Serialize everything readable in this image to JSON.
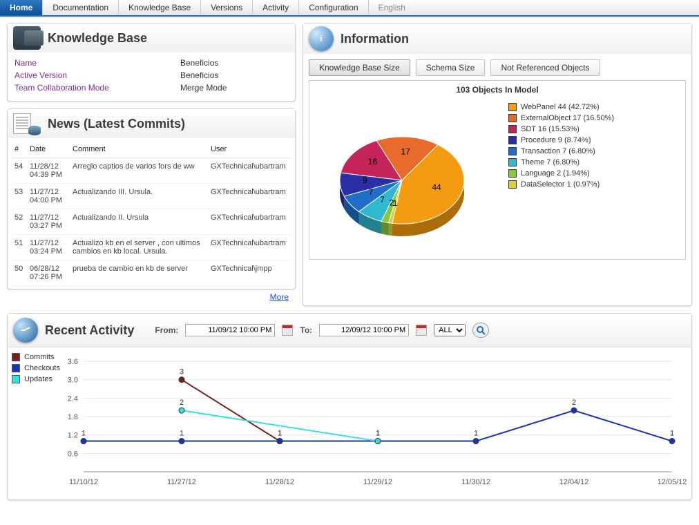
{
  "nav": {
    "tabs": [
      "Home",
      "Documentation",
      "Knowledge Base",
      "Versions",
      "Activity",
      "Configuration"
    ],
    "lang": "English"
  },
  "kb": {
    "title": "Knowledge Base",
    "rows": [
      {
        "label": "Name",
        "value": "Beneficios"
      },
      {
        "label": "Active Version",
        "value": "Beneficios"
      },
      {
        "label": "Team Collaboration Mode",
        "value": "Merge Mode"
      }
    ]
  },
  "news": {
    "title": "News (Latest Commits)",
    "headers": [
      "#",
      "Date",
      "Comment",
      "User"
    ],
    "rows": [
      {
        "n": "54",
        "date": "11/28/12 04:39 PM",
        "comment": "Arreglo captios de varios fors de ww",
        "user": "GXTechnical\\ubartram"
      },
      {
        "n": "53",
        "date": "11/27/12 04:00 PM",
        "comment": "Actualizando III. Ursula.",
        "user": "GXTechnical\\ubartram"
      },
      {
        "n": "52",
        "date": "11/27/12 03:27 PM",
        "comment": "Actualizando II. Ursula",
        "user": "GXTechnical\\ubartram"
      },
      {
        "n": "51",
        "date": "11/27/12 03:24 PM",
        "comment": "Actualizo kb en el server , con ultimos cambios en kb local. Ursula.",
        "user": "GXTechnical\\ubartram"
      },
      {
        "n": "50",
        "date": "06/28/12 07:26 PM",
        "comment": "prueba de cambio en kb de server",
        "user": "GXTechnical\\jmpp"
      }
    ],
    "more": "More"
  },
  "info": {
    "title": "Information",
    "tabs": [
      "Knowledge Base Size",
      "Schema Size",
      "Not Referenced Objects"
    ],
    "chart_title": "103 Objects In Model"
  },
  "activity": {
    "title": "Recent Activity",
    "from_label": "From:",
    "to_label": "To:",
    "from": "11/09/12 10:00 PM",
    "to": "12/09/12 10:00 PM",
    "filter": "ALL"
  },
  "chart_data": [
    {
      "type": "pie",
      "title": "103 Objects In Model",
      "series": [
        {
          "name": "WebPanel",
          "value": 44,
          "pct": "42.72%",
          "color": "#f59b0f"
        },
        {
          "name": "ExternalObject",
          "value": 17,
          "pct": "16.50%",
          "color": "#e96b2c"
        },
        {
          "name": "SDT",
          "value": 16,
          "pct": "15.53%",
          "color": "#c4245a"
        },
        {
          "name": "Procedure",
          "value": 9,
          "pct": "8.74%",
          "color": "#2a2fa8"
        },
        {
          "name": "Transaction",
          "value": 7,
          "pct": "6.80%",
          "color": "#1f6fc9"
        },
        {
          "name": "Theme",
          "value": 7,
          "pct": "6.80%",
          "color": "#2fb8cf"
        },
        {
          "name": "Language",
          "value": 2,
          "pct": "1.94%",
          "color": "#8bc63f"
        },
        {
          "name": "DataSelector",
          "value": 1,
          "pct": "0.97%",
          "color": "#d9d13a"
        }
      ]
    },
    {
      "type": "line",
      "title": "Recent Activity",
      "categories": [
        "11/10/12",
        "11/27/12",
        "11/28/12",
        "11/29/12",
        "11/30/12",
        "12/04/12",
        "12/05/12"
      ],
      "ylim": [
        0,
        3.6
      ],
      "yticks": [
        0.6,
        1.2,
        1.8,
        2.4,
        3.0,
        3.6
      ],
      "series": [
        {
          "name": "Commits",
          "color": "#7a1d1d",
          "points": [
            {
              "x": "11/27/12",
              "y": 3
            },
            {
              "x": "11/28/12",
              "y": 1
            }
          ]
        },
        {
          "name": "Checkouts",
          "color": "#1433c2",
          "points": [
            {
              "x": "11/10/12",
              "y": 1
            },
            {
              "x": "11/27/12",
              "y": 1
            },
            {
              "x": "11/28/12",
              "y": 1
            },
            {
              "x": "11/29/12",
              "y": 1
            },
            {
              "x": "11/30/12",
              "y": 1
            },
            {
              "x": "12/04/12",
              "y": 2
            },
            {
              "x": "12/05/12",
              "y": 1
            }
          ]
        },
        {
          "name": "Updates",
          "color": "#36e0dc",
          "points": [
            {
              "x": "11/27/12",
              "y": 2
            },
            {
              "x": "11/29/12",
              "y": 1
            }
          ]
        }
      ]
    }
  ]
}
